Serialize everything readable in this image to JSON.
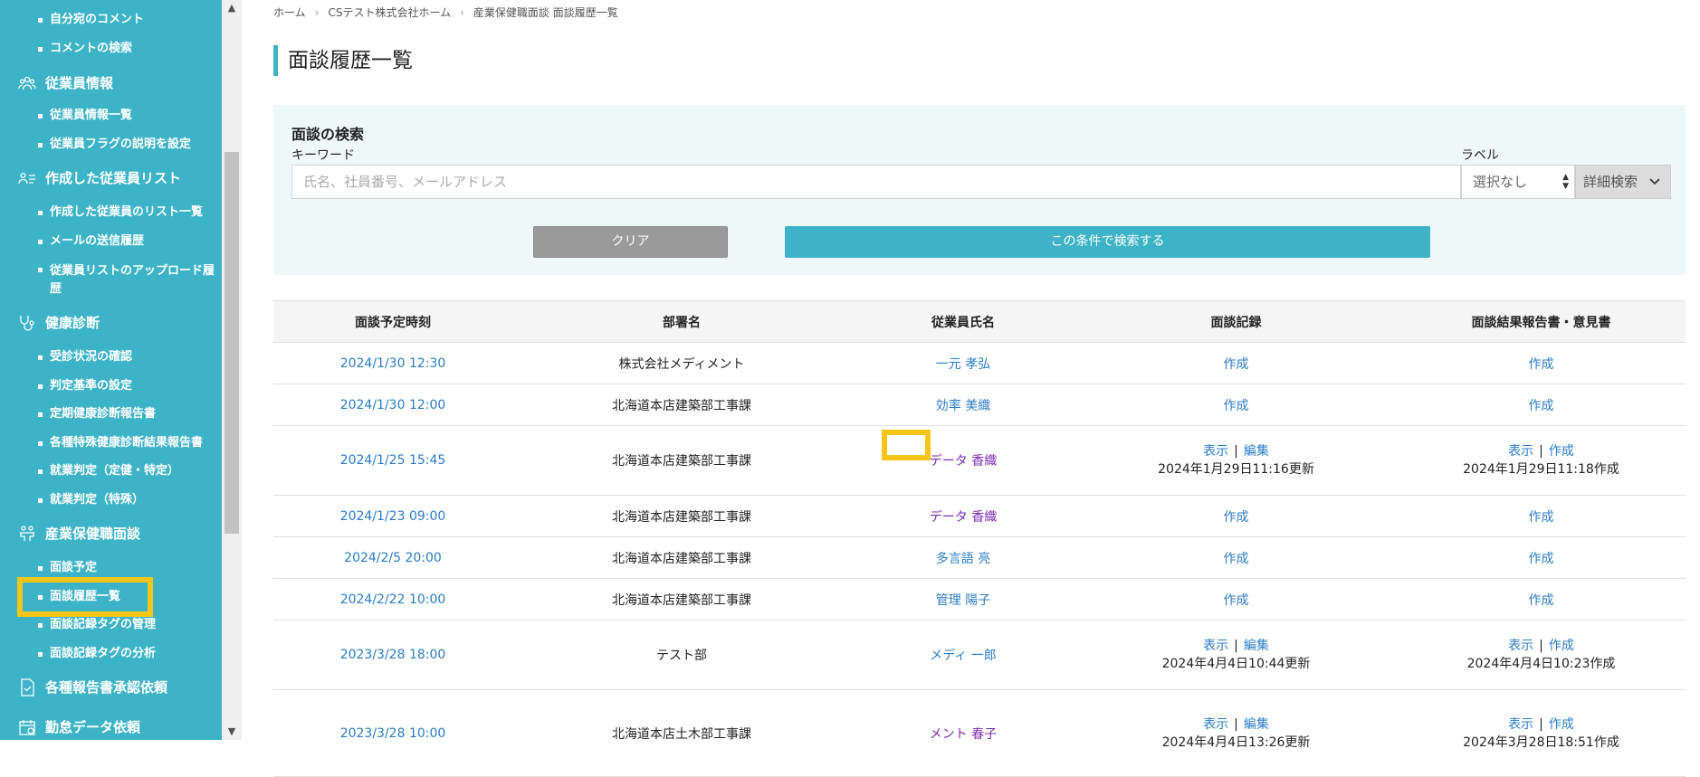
{
  "sidebar": {
    "top_items": [
      "自分宛のコメント",
      "コメントの検索"
    ],
    "groups": [
      {
        "title": "従業員情報",
        "icon": "people-icon",
        "items": [
          "従業員情報一覧",
          "従業員フラグの説明を設定"
        ]
      },
      {
        "title": "作成した従業員リスト",
        "icon": "user-list-icon",
        "items": [
          "作成した従業員のリスト一覧",
          "メールの送信履歴",
          "従業員リストのアップロード履歴"
        ]
      },
      {
        "title": "健康診断",
        "icon": "stethoscope-icon",
        "items": [
          "受診状況の確認",
          "判定基準の設定",
          "定期健康診断報告書",
          "各種特殊健康診断結果報告書",
          "就業判定（定健・特定）",
          "就業判定（特殊）"
        ]
      },
      {
        "title": "産業保健職面談",
        "icon": "interview-icon",
        "items": [
          "面談予定",
          "面談履歴一覧",
          "面談記録タグの管理",
          "面談記録タグの分析"
        ]
      },
      {
        "title": "各種報告書承認依頼",
        "icon": "document-check-icon",
        "items": []
      },
      {
        "title": "勤怠データ依頼",
        "icon": "calendar-icon",
        "items": []
      }
    ],
    "bg_color": "#3db3c8",
    "highlight_color": "#f5c518"
  },
  "breadcrumb": [
    "ホーム",
    "CSテスト株式会社ホーム",
    "産業保健職面談 面談履歴一覧"
  ],
  "page_title": "面談履歴一覧",
  "search": {
    "title": "面談の検索",
    "keyword_label": "キーワード",
    "keyword_placeholder": "氏名、社員番号、メールアドレス",
    "label_label": "ラベル",
    "label_value": "選択なし",
    "detail_button": "詳細検索",
    "clear_button": "クリア",
    "search_button": "この条件で検索する"
  },
  "table": {
    "headers": [
      "面談予定時刻",
      "部署名",
      "従業員氏名",
      "面談記録",
      "面談結果報告書・意見書"
    ],
    "rows": [
      {
        "time": "2024/1/30 12:30",
        "dept": "株式会社メディメント",
        "name": "一元 孝弘",
        "record_create": "作成",
        "report_create": "作成"
      },
      {
        "time": "2024/1/30 12:00",
        "dept": "北海道本店建築部工事課",
        "name": "効率 美織",
        "record_create": "作成",
        "report_create": "作成"
      },
      {
        "time": "2024/1/25 15:45",
        "dept": "北海道本店建築部工事課",
        "name": "データ 香織",
        "record_view": "表示",
        "record_edit": "編集",
        "record_note": "2024年1月29日11:16更新",
        "report_view": "表示",
        "report_create": "作成",
        "report_note": "2024年1月29日11:18作成"
      },
      {
        "time": "2024/1/23 09:00",
        "dept": "北海道本店建築部工事課",
        "name": "データ 香織",
        "record_create": "作成",
        "report_create": "作成"
      },
      {
        "time": "2024/2/5 20:00",
        "dept": "北海道本店建築部工事課",
        "name": "多言語 亮",
        "record_create": "作成",
        "report_create": "作成"
      },
      {
        "time": "2024/2/22 10:00",
        "dept": "北海道本店建築部工事課",
        "name": "管理 陽子",
        "record_create": "作成",
        "report_create": "作成"
      },
      {
        "time": "2023/3/28 18:00",
        "dept": "テスト部",
        "name": "メディ 一郎",
        "record_view": "表示",
        "record_edit": "編集",
        "record_note": "2024年4月4日10:44更新",
        "report_view": "表示",
        "report_create": "作成",
        "report_note": "2024年4月4日10:23作成"
      },
      {
        "time": "2023/3/28 10:00",
        "dept": "北海道本店土木部工事課",
        "name": "メント 春子",
        "record_view": "表示",
        "record_edit": "編集",
        "record_note": "2024年4月4日13:26更新",
        "report_view": "表示",
        "report_create": "作成",
        "report_note": "2024年3月28日18:51作成"
      }
    ]
  },
  "colors": {
    "accent": "#3db3c8",
    "link": "#2a7cc7",
    "visited_link": "#7b2bb3",
    "clear_button": "#9a9a9a"
  }
}
